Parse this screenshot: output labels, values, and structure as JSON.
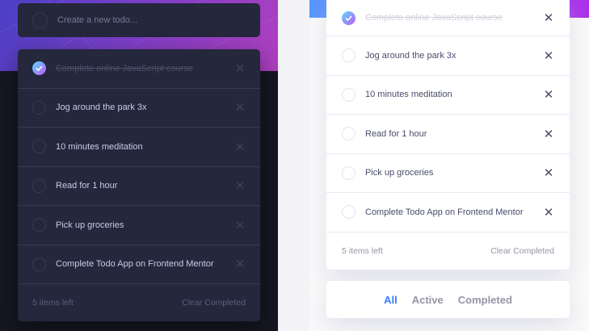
{
  "dark": {
    "new_todo_placeholder": "Create a new todo...",
    "items": [
      {
        "label": "Complete online JavaScript course",
        "completed": true
      },
      {
        "label": "Jog around the park 3x",
        "completed": false
      },
      {
        "label": "10 minutes meditation",
        "completed": false
      },
      {
        "label": "Read for 1 hour",
        "completed": false
      },
      {
        "label": "Pick up groceries",
        "completed": false
      },
      {
        "label": "Complete Todo App on Frontend Mentor",
        "completed": false
      }
    ],
    "items_left": "5 items left",
    "clear_completed": "Clear Completed"
  },
  "light": {
    "items": [
      {
        "label": "Complete online JavaScript course",
        "completed": true
      },
      {
        "label": "Jog around the park 3x",
        "completed": false
      },
      {
        "label": "10 minutes meditation",
        "completed": false
      },
      {
        "label": "Read for 1 hour",
        "completed": false
      },
      {
        "label": "Pick up groceries",
        "completed": false
      },
      {
        "label": "Complete Todo App on Frontend Mentor",
        "completed": false
      }
    ],
    "items_left": "5 items left",
    "clear_completed": "Clear Completed",
    "filters": {
      "all": "All",
      "active": "Active",
      "completed": "Completed"
    },
    "active_filter": "all"
  },
  "icons": {
    "delete": "close-icon",
    "check": "check-icon"
  },
  "colors": {
    "accent": "#3a7cfd",
    "check_start": "#57ddff",
    "check_end": "#c058f3"
  }
}
